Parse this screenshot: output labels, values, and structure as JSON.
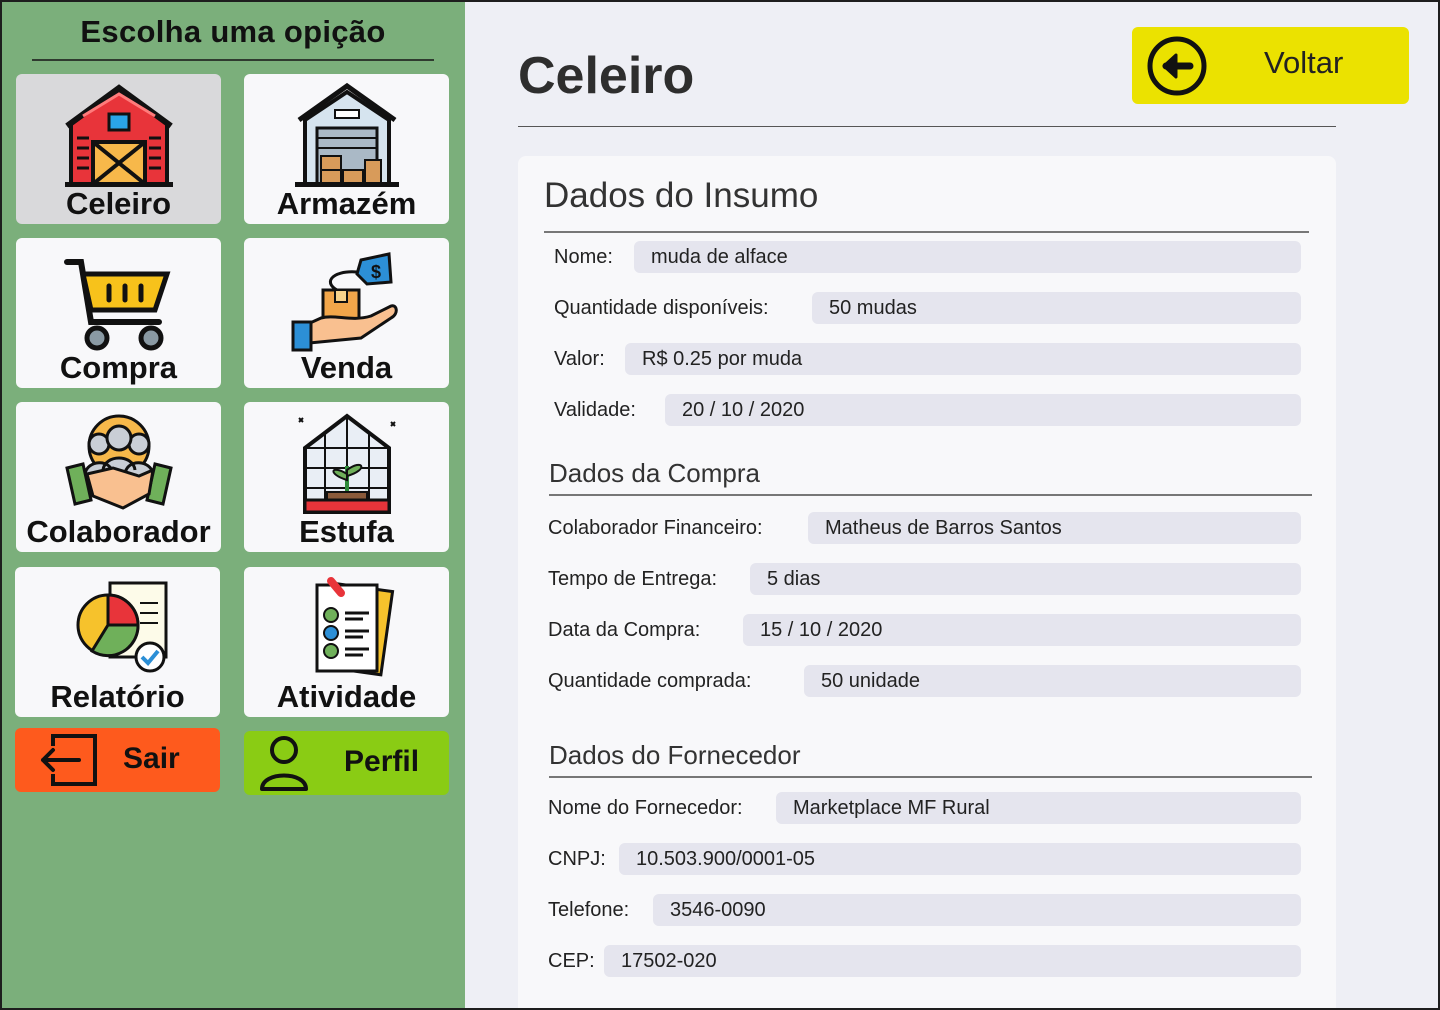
{
  "sidebar": {
    "title": "Escolha uma opição",
    "tiles": [
      {
        "label": "Celeiro",
        "icon": "barn-icon",
        "active": true
      },
      {
        "label": "Armazém",
        "icon": "warehouse-icon"
      },
      {
        "label": "Compra",
        "icon": "shopping-cart-icon"
      },
      {
        "label": "Venda",
        "icon": "sale-hand-icon"
      },
      {
        "label": "Colaborador",
        "icon": "partnership-icon"
      },
      {
        "label": "Estufa",
        "icon": "greenhouse-icon"
      },
      {
        "label": "Relatório",
        "icon": "report-icon"
      },
      {
        "label": "Atividade",
        "icon": "checklist-icon"
      }
    ],
    "sair_label": "Sair",
    "perfil_label": "Perfil"
  },
  "header": {
    "title": "Celeiro",
    "back_label": "Voltar"
  },
  "insumo": {
    "title": "Dados do Insumo",
    "fields": [
      {
        "label": "Nome:",
        "value": "muda de alface"
      },
      {
        "label": "Quantidade disponíveis:",
        "value": "50 mudas"
      },
      {
        "label": "Valor:",
        "value": "R$ 0.25 por muda"
      },
      {
        "label": "Validade:",
        "value": "20 / 10 / 2020"
      }
    ]
  },
  "compra": {
    "title": "Dados da Compra",
    "fields": [
      {
        "label": "Colaborador Financeiro:",
        "value": "Matheus de Barros Santos"
      },
      {
        "label": "Tempo de Entrega:",
        "value": "5 dias"
      },
      {
        "label": "Data da Compra:",
        "value": "15 / 10 / 2020"
      },
      {
        "label": "Quantidade comprada:",
        "value": "50 unidade"
      }
    ]
  },
  "fornecedor": {
    "title": "Dados do Fornecedor",
    "fields": [
      {
        "label": "Nome do Fornecedor:",
        "value": "Marketplace MF Rural"
      },
      {
        "label": "CNPJ:",
        "value": "10.503.900/0001-05"
      },
      {
        "label": "Telefone:",
        "value": "3546-0090"
      },
      {
        "label": "CEP:",
        "value": "17502-020"
      }
    ]
  },
  "colors": {
    "sidebar_bg": "#7baf7b",
    "sair_bg": "#fe5a1d",
    "perfil_bg": "#8acc14",
    "voltar_bg": "#ebe200",
    "main_bg": "#eeeff5"
  }
}
